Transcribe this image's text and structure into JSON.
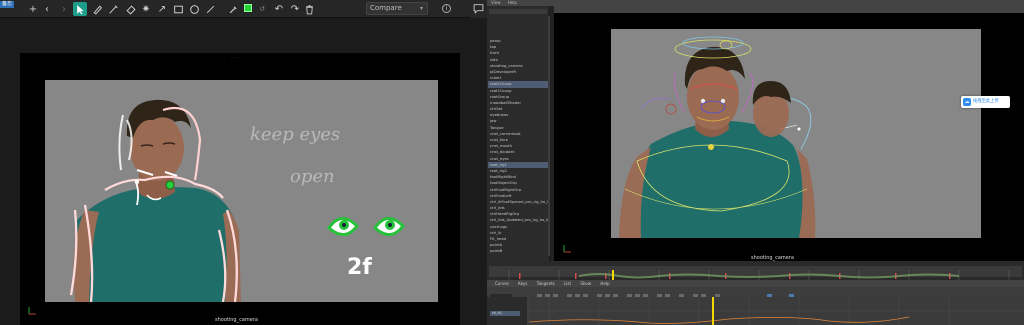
{
  "left_app": {
    "badge": "备忘",
    "compare": {
      "label": "Compare"
    },
    "brush_color": "#27d13a",
    "toolbar_icons": [
      "plus-icon",
      "back-icon",
      "forward-icon",
      "select-icon",
      "pen-icon",
      "pencil-icon",
      "eraser-icon",
      "laser-icon",
      "arrow-icon",
      "rectangle-icon",
      "circle-icon",
      "line-icon",
      "eyedropper-icon",
      "color-swatch",
      "undo-icon",
      "redo-icon",
      "trash-icon"
    ],
    "camera_label": "shooting_camera",
    "notes": {
      "line1": "keep eyes",
      "line2": "open",
      "frames": "2f"
    },
    "accent": "#1e9e8a"
  },
  "maya": {
    "menu": [
      "View",
      "Help"
    ],
    "outliner_items": [
      {
        "label": "persp",
        "selected": false
      },
      {
        "label": "top",
        "selected": false
      },
      {
        "label": "front",
        "selected": false
      },
      {
        "label": "side",
        "selected": false
      },
      {
        "label": "shooting_camera",
        "selected": false
      },
      {
        "label": "ptDeveloperR",
        "selected": false
      },
      {
        "label": "cube1",
        "selected": false
      },
      {
        "label": "root1Group",
        "selected": true
      },
      {
        "label": "root1Group",
        "selected": false
      },
      {
        "label": "rootGroup",
        "selected": false
      },
      {
        "label": "moodballShader",
        "selected": false
      },
      {
        "label": "ctrlSet",
        "selected": false
      },
      {
        "label": "eyebrows",
        "selected": false
      },
      {
        "label": "jaw",
        "selected": false
      },
      {
        "label": "Tongue",
        "selected": false
      },
      {
        "label": "cnst_cornerboot",
        "selected": false
      },
      {
        "label": "cnst_face",
        "selected": false
      },
      {
        "label": "cnst_mouth",
        "selected": false
      },
      {
        "label": "cnst_doublet",
        "selected": false
      },
      {
        "label": "cnst_eyes",
        "selected": false
      },
      {
        "label": "root_rig1",
        "selected": true
      },
      {
        "label": "root_rig2",
        "selected": false
      },
      {
        "label": "footRightBlnd",
        "selected": false
      },
      {
        "label": "footObjectGrp",
        "selected": false
      },
      {
        "label": "ctrlFootRightGrp",
        "selected": false
      },
      {
        "label": "ctrlFootLeft",
        "selected": false
      },
      {
        "label": "ctrl_ikFootSpaced_pro_rig_ho_ifs",
        "selected": false
      },
      {
        "label": "ctrl_lids",
        "selected": false
      },
      {
        "label": "ctrlHeadRigGrp",
        "selected": false
      },
      {
        "label": "ctrl_lids_Updated_pro_rig_ho_ifs",
        "selected": false
      },
      {
        "label": "userLogs",
        "selected": false
      },
      {
        "label": "ctrl_ik",
        "selected": false
      },
      {
        "label": "FK_head",
        "selected": false
      },
      {
        "label": "pointA",
        "selected": false
      },
      {
        "label": "pointB",
        "selected": false
      }
    ],
    "camera_label": "shooting_camera",
    "popup": {
      "text": "拖拽至此上传"
    },
    "graph_menu": [
      "Curves",
      "Keys",
      "Tangents",
      "List",
      "Show",
      "Help"
    ],
    "graph_channel": "rtl_d1",
    "current_frame_color": "#f5d800"
  }
}
